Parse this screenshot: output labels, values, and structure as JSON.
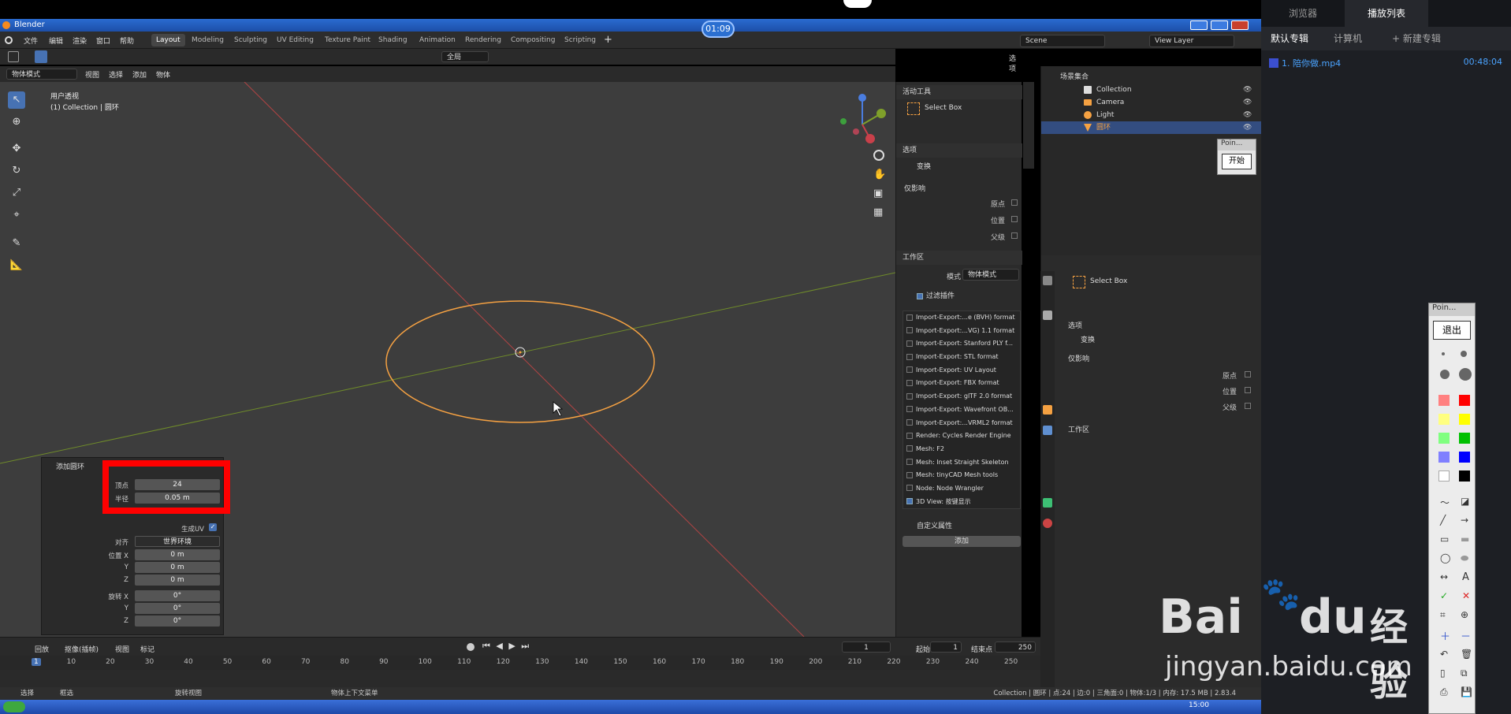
{
  "window": {
    "title": "Blender",
    "timer": "01:09"
  },
  "menu": [
    "文件",
    "编辑",
    "渲染",
    "窗口",
    "帮助"
  ],
  "workspaces": [
    {
      "label": "Layout",
      "active": true
    },
    {
      "label": "Modeling"
    },
    {
      "label": "Sculpting"
    },
    {
      "label": "UV Editing"
    },
    {
      "label": "Texture Paint"
    },
    {
      "label": "Shading"
    },
    {
      "label": "Animation"
    },
    {
      "label": "Rendering"
    },
    {
      "label": "Compositing"
    },
    {
      "label": "Scripting"
    }
  ],
  "scene": "Scene",
  "view_layer": "View Layer",
  "view_header": {
    "mode": "物体模式",
    "menus": [
      "视图",
      "选择",
      "添加",
      "物体"
    ],
    "transform": "全局",
    "options": "选项"
  },
  "viewport": {
    "title": "用户透视",
    "subtitle": "(1) Collection | 圆环"
  },
  "npanel": {
    "active_tool": "活动工具",
    "select_box": "Select Box",
    "options": "选项",
    "transform": "变换",
    "affect_only": "仅影响",
    "origin": "原点",
    "location": "位置",
    "parent": "父级",
    "workspace": "工作区",
    "mode_label": "模式",
    "mode_value": "物体模式",
    "filter_addons": "过滤插件",
    "addons": [
      {
        "label": "Import-Export:...e (BVH) format",
        "checked": false
      },
      {
        "label": "Import-Export:...VG) 1.1 format",
        "checked": false
      },
      {
        "label": "Import-Export: Stanford PLY f...",
        "checked": false
      },
      {
        "label": "Import-Export: STL format",
        "checked": false
      },
      {
        "label": "Import-Export: UV Layout",
        "checked": false
      },
      {
        "label": "Import-Export: FBX format",
        "checked": false
      },
      {
        "label": "Import-Export: glTF 2.0 format",
        "checked": false
      },
      {
        "label": "Import-Export: Wavefront OB...",
        "checked": false
      },
      {
        "label": "Import-Export:...VRML2 format",
        "checked": false
      },
      {
        "label": "Render: Cycles Render Engine",
        "checked": false
      },
      {
        "label": "Mesh: F2",
        "checked": false
      },
      {
        "label": "Mesh: Inset Straight Skeleton",
        "checked": false
      },
      {
        "label": "Mesh: tinyCAD Mesh tools",
        "checked": false
      },
      {
        "label": "Node: Node Wrangler",
        "checked": false
      },
      {
        "label": "3D View: 按键显示",
        "checked": true
      }
    ],
    "custom_props": "自定义属性",
    "add": "添加"
  },
  "outliner": {
    "root": "场景集合",
    "rows": [
      {
        "label": "Collection",
        "icon": "collection-icon"
      },
      {
        "label": "Camera",
        "icon": "camera-icon"
      },
      {
        "label": "Light",
        "icon": "light-icon"
      },
      {
        "label": "圆环",
        "icon": "mesh-icon",
        "selected": true
      }
    ]
  },
  "props": {
    "select_box": "Select Box",
    "options": "选项",
    "transform": "变换",
    "affect_only": "仅影响",
    "origin": "原点",
    "location": "位置",
    "parent": "父级",
    "workspace": "工作区"
  },
  "operator_panel": {
    "title": "添加圆环",
    "vertices_label": "顶点",
    "vertices_value": "24",
    "radius_label": "半径",
    "radius_value": "0.05 m",
    "gen_uv": "生成UV",
    "align_label": "对齐",
    "align_value": "世界环境",
    "loc_x_label": "位置 X",
    "loc_x": "0 m",
    "loc_y_label": "Y",
    "loc_y": "0 m",
    "loc_z_label": "Z",
    "loc_z": "0 m",
    "rot_x_label": "旋转 X",
    "rot_x": "0°",
    "rot_y_label": "Y",
    "rot_y": "0°",
    "rot_z_label": "Z",
    "rot_z": "0°"
  },
  "timeline": {
    "menus": [
      "回放",
      "抠像(插帧)",
      "视图",
      "标记"
    ],
    "current": "1",
    "start_label": "起始",
    "start": "1",
    "end_label": "结束点",
    "end": "250",
    "ticks": [
      "1",
      "10",
      "20",
      "30",
      "40",
      "50",
      "60",
      "70",
      "80",
      "90",
      "100",
      "110",
      "120",
      "130",
      "140",
      "150",
      "160",
      "170",
      "180",
      "190",
      "200",
      "210",
      "220",
      "230",
      "240",
      "250"
    ]
  },
  "statusbar": {
    "select": "选择",
    "box_select": "框选",
    "rotate_view": "旋转视图",
    "context_menu": "物体上下文菜单",
    "info": "Collection | 圆环 | 点:24 | 边:0 | 三角面:0 | 物体:1/3 | 内存: 17.5 MB | 2.83.4"
  },
  "taskbar": {
    "time": "15:00"
  },
  "player": {
    "tabs": [
      "浏览器",
      "播放列表"
    ],
    "subtabs": [
      "默认专辑",
      "计算机",
      "+ 新建专辑"
    ],
    "item": "1. 陪你做.mp4",
    "duration": "00:48:04"
  },
  "pointer_small": {
    "title": "Poin...",
    "button": "开始"
  },
  "pointer_big": {
    "title": "Poin...",
    "button": "退出",
    "colors": [
      "#ff8080",
      "#ff0000",
      "#ffff80",
      "#ffff00",
      "#80ff80",
      "#00c000",
      "#8080ff",
      "#0000ff",
      "#ffffff",
      "#000000"
    ]
  },
  "watermark": {
    "text": "Bai",
    "brand": "经验",
    "url": "jingyan.baidu.com"
  }
}
